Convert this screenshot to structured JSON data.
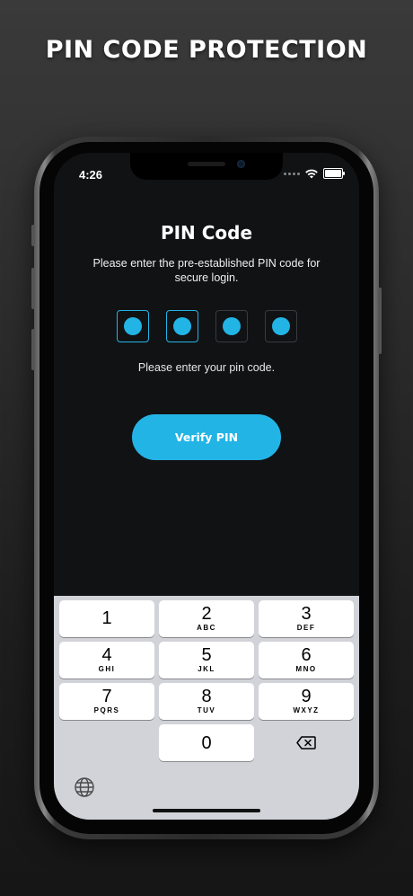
{
  "headline": "PIN CODE PROTECTION",
  "status_bar": {
    "time": "4:26"
  },
  "pin_screen": {
    "title": "PIN Code",
    "subtitle": "Please enter the pre-established PIN code for secure login.",
    "hint": "Please enter your pin code.",
    "verify_label": "Verify PIN",
    "filled_count": 2,
    "total_digits": 4
  },
  "keypad": {
    "keys": [
      {
        "num": "1",
        "letters": ""
      },
      {
        "num": "2",
        "letters": "ABC"
      },
      {
        "num": "3",
        "letters": "DEF"
      },
      {
        "num": "4",
        "letters": "GHI"
      },
      {
        "num": "5",
        "letters": "JKL"
      },
      {
        "num": "6",
        "letters": "MNO"
      },
      {
        "num": "7",
        "letters": "PQRS"
      },
      {
        "num": "8",
        "letters": "TUV"
      },
      {
        "num": "9",
        "letters": "WXYZ"
      },
      {
        "num": "0",
        "letters": ""
      }
    ]
  },
  "colors": {
    "accent": "#23b4e6",
    "screen_bg": "#111214",
    "keypad_bg": "#d1d3d9"
  },
  "icons": {
    "backspace": "backspace-icon",
    "globe": "globe-icon",
    "wifi": "wifi-icon",
    "battery": "battery-icon"
  }
}
